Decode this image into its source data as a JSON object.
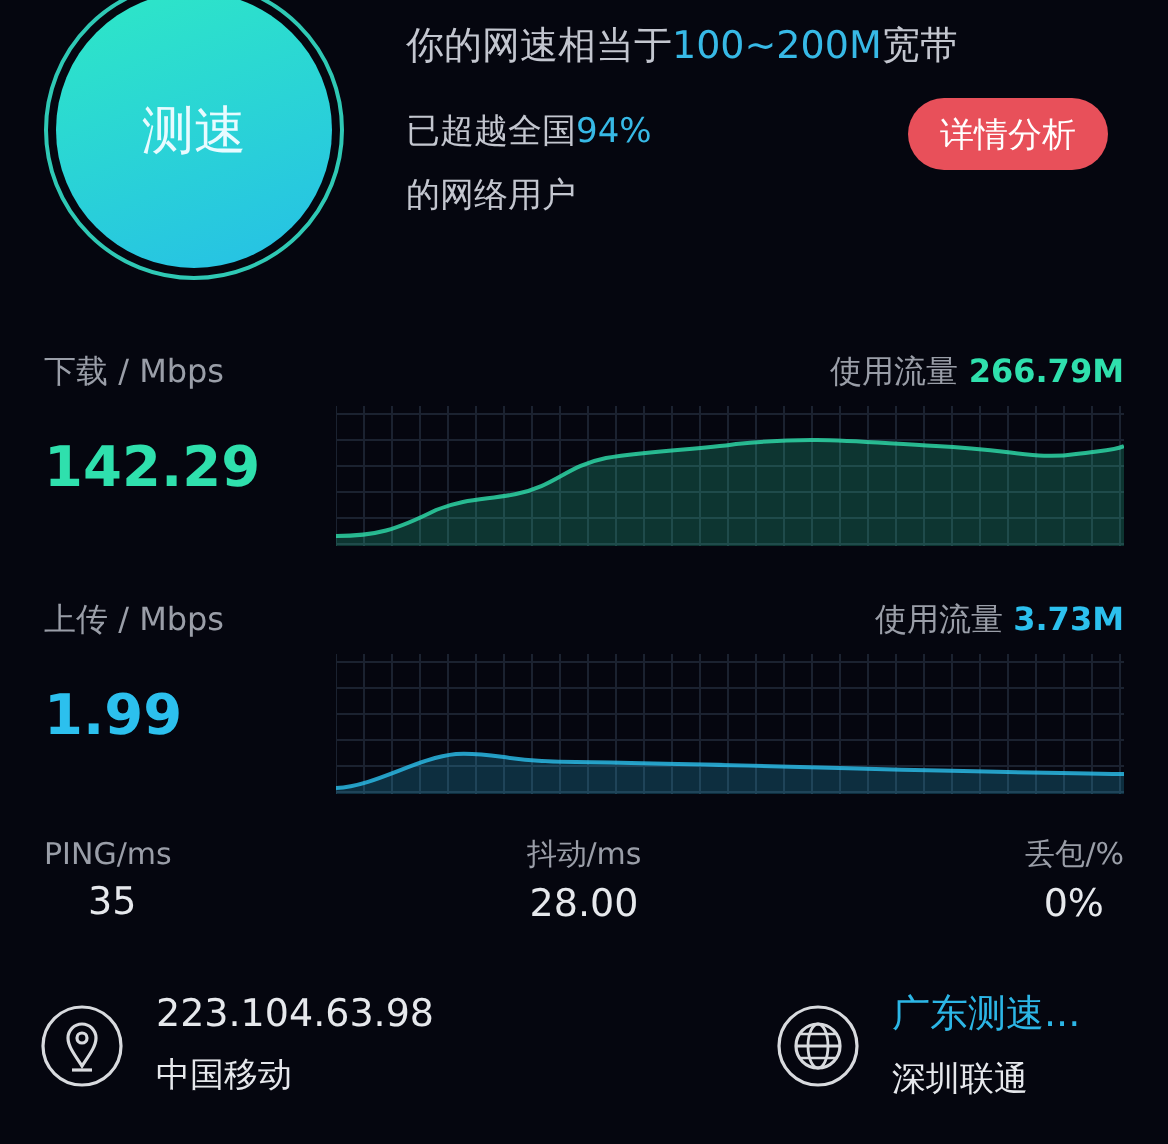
{
  "speed_button": {
    "label": "测速"
  },
  "headline": {
    "text": "你的网速相当于",
    "value": "100~200M",
    "suffix": "宽带"
  },
  "rank": {
    "text": "已超越全国",
    "value": "94%",
    "line2": "的网络用户"
  },
  "detail_button": {
    "label": "详情分析"
  },
  "metrics": [
    {
      "kind": "download",
      "label": "下载 / Mbps",
      "value": "142.29",
      "usage_label": "使用流量",
      "usage": "266.79M",
      "color": "#2fe0ad"
    },
    {
      "kind": "upload",
      "label": "上传 / Mbps",
      "value": "1.99",
      "usage_label": "使用流量",
      "usage": "3.73M",
      "color": "#2cc0ee"
    }
  ],
  "stats": [
    {
      "label": "PING/ms",
      "value": "35"
    },
    {
      "label": "抖动/ms",
      "value": "28.00"
    },
    {
      "label": "丢包/%",
      "value": "0%"
    }
  ],
  "servers": [
    {
      "kind": "location",
      "title": "223.104.63.98",
      "subtitle": "中国移动",
      "highlighted": false
    },
    {
      "kind": "globe",
      "title": "广东测速...",
      "subtitle": "深圳联通",
      "highlighted": true
    }
  ]
}
